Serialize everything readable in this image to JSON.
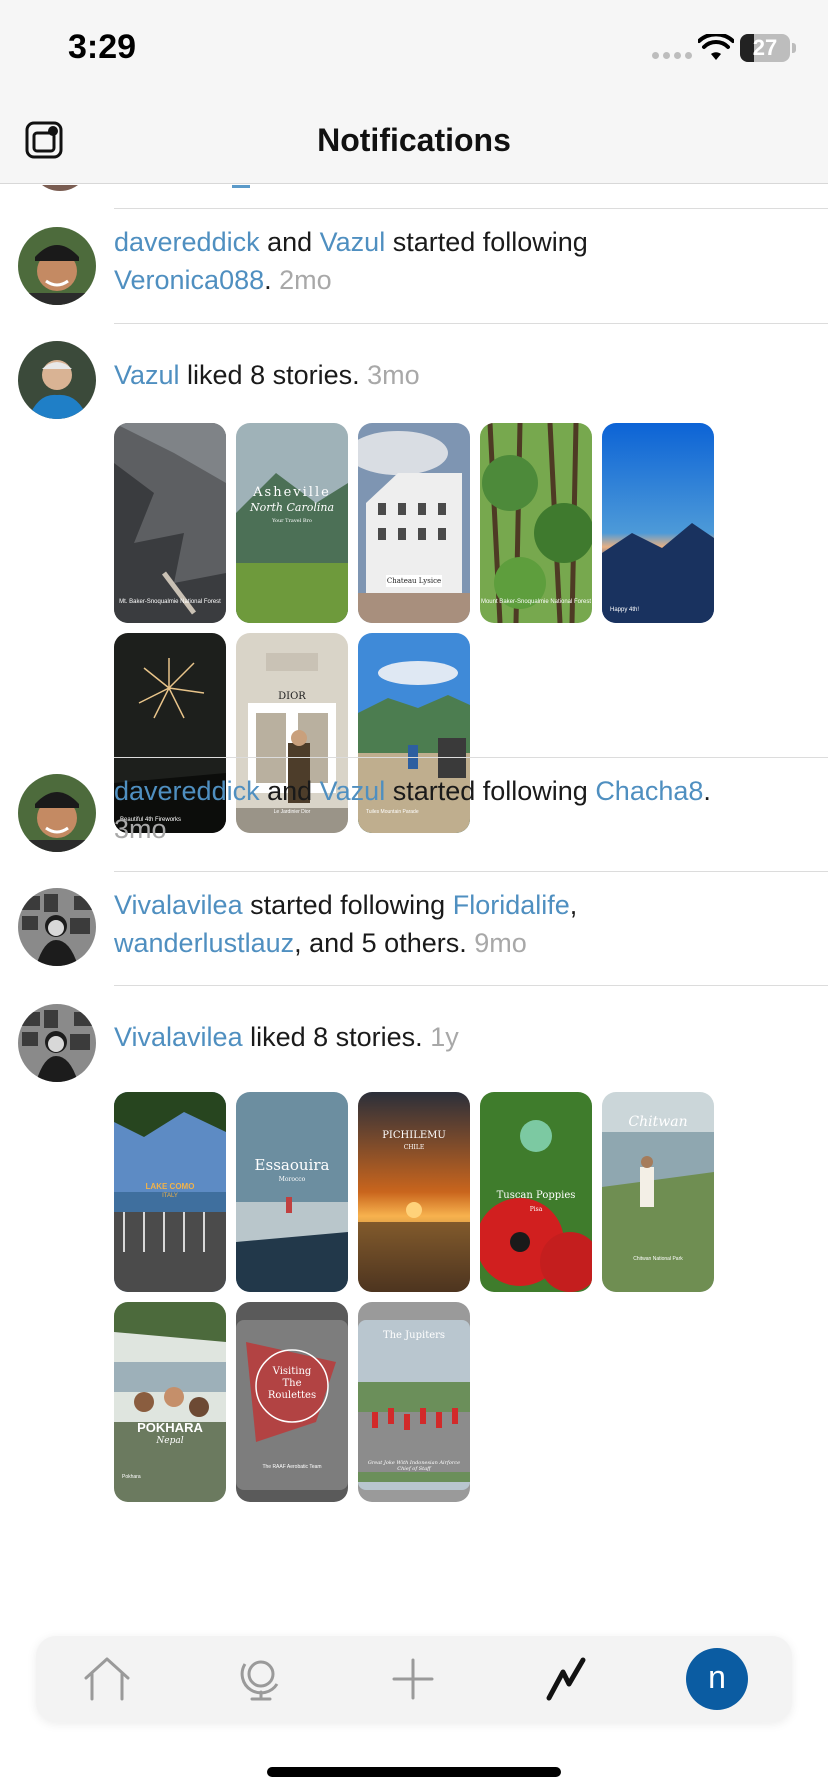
{
  "status_bar": {
    "time": "3:29",
    "battery": "27",
    "battery_level": 0.27
  },
  "header": {
    "title": "Notifications",
    "left_icon": "instagram-style-app-icon"
  },
  "notifications": [
    {
      "avatar": "davereddick-avatar",
      "line1_user1": "davereddick",
      "line1_and": " and ",
      "line1_user2": "Vazul",
      "line1_action": " started following",
      "line2_target": "Veronica088",
      "line2_period": ".",
      "time": "2mo"
    },
    {
      "avatar": "vazul-avatar",
      "user": "Vazul",
      "action": " liked 8 stories.",
      "time": "3mo",
      "stories": [
        {
          "caption": "Mt. Baker-Snoqualmie National Forest",
          "color": "#5d5f62"
        },
        {
          "title": "Asheville",
          "subtitle": "North Carolina",
          "tag": "Your Travel Bro",
          "color": "#4c7056"
        },
        {
          "title": "Chateau Lysice",
          "color": "#9aa6b3"
        },
        {
          "caption": "Mount Baker-Snoqualmie National Forest",
          "color": "#4d8a3a"
        },
        {
          "caption": "Happy 4th!",
          "color": "#1c57b8"
        },
        {
          "caption": "Beautiful 4th Fireworks",
          "color": "#1d1f1c"
        },
        {
          "title": "DIOR",
          "caption": "Le Jardinier Dior",
          "color": "#c9c2b5"
        },
        {
          "caption": "Tuiles Mountain Parade",
          "color": "#4c7d9a"
        }
      ]
    },
    {
      "avatar": "davereddick-avatar",
      "line1_user1": "davereddick",
      "line1_and": " and ",
      "line1_user2": "Vazul",
      "line1_action": " started following ",
      "line1_target": "Chacha8",
      "line1_period": ".",
      "time": "3mo"
    },
    {
      "avatar": "vivalavilea-avatar",
      "line1_user": "Vivalavilea",
      "line1_action": " started following ",
      "line1_target": "Floridalife",
      "line1_comma": ",",
      "line2_target": "wanderlustlauz",
      "line2_rest": ", and 5 others.",
      "time": "9mo"
    },
    {
      "avatar": "vivalavilea-avatar",
      "user": "Vivalavilea",
      "action": " liked 8 stories.",
      "time": "1y",
      "stories": [
        {
          "title": "LAKE COMO",
          "subtitle": "ITALY",
          "color": "#3f6f9e"
        },
        {
          "title": "Essaouira",
          "subtitle": "Morocco",
          "color": "#6c8ea0"
        },
        {
          "title": "PICHILEMU",
          "subtitle": "CHILE",
          "color": "#b0571a"
        },
        {
          "title": "Tuscan Poppies",
          "subtitle": "Pisa",
          "color": "#c41e1e"
        },
        {
          "title": "Chitwan",
          "caption": "Chitwan National Park",
          "color": "#6f8e52"
        },
        {
          "title": "POKHARA",
          "subtitle": "Nepal",
          "caption": "Pokhara",
          "color": "#6b7a5f"
        },
        {
          "title": "Visiting The Roulettes",
          "caption": "The RAAF Aerobatic Team",
          "color": "#5a5a5a"
        },
        {
          "title": "The Jupiters",
          "caption": "Great Joke With Indonesian Airforce Chief of Staff",
          "color": "#9a9a9a"
        }
      ]
    }
  ],
  "tabbar": {
    "items": [
      "home-icon",
      "globe-icon",
      "plus-icon",
      "activity-icon"
    ],
    "profile_initial": "n",
    "profile_color": "#0b5ca2"
  },
  "colors": {
    "link": "#4f8fc0",
    "time": "#a8a8a8",
    "accent": "#0b5ca2"
  }
}
